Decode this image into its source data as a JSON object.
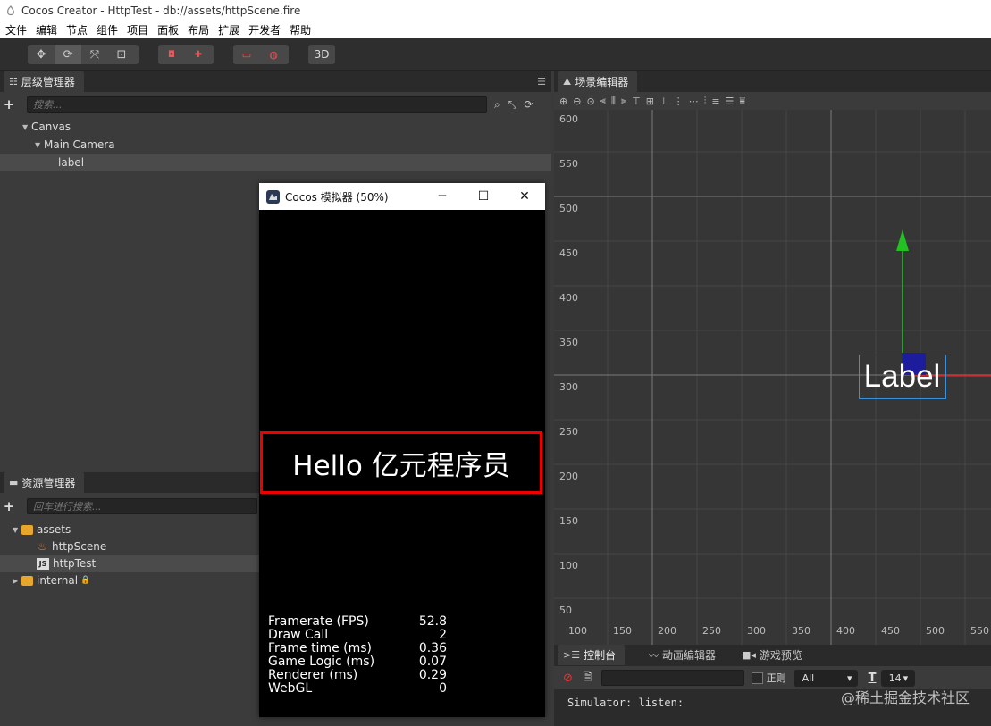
{
  "window": {
    "title": "Cocos Creator - HttpTest - db://assets/httpScene.fire"
  },
  "menu": [
    "文件",
    "编辑",
    "节点",
    "组件",
    "项目",
    "面板",
    "布局",
    "扩展",
    "开发者",
    "帮助"
  ],
  "toolbar": {
    "toggle_3d": "3D"
  },
  "hierarchy": {
    "tab": "层级管理器",
    "search_placeholder": "搜索...",
    "nodes": [
      {
        "label": "Canvas",
        "level": 0,
        "expanded": true
      },
      {
        "label": "Main Camera",
        "level": 1,
        "expanded": true
      },
      {
        "label": "label",
        "level": 2,
        "selected": true
      }
    ]
  },
  "assets": {
    "tab": "资源管理器",
    "search_placeholder": "回车进行搜索...",
    "items": [
      {
        "label": "assets",
        "type": "folder",
        "expanded": true
      },
      {
        "label": "httpScene",
        "type": "scene"
      },
      {
        "label": "httpTest",
        "type": "js",
        "selected": true
      },
      {
        "label": "internal",
        "type": "folder",
        "locked": true
      }
    ]
  },
  "scene": {
    "tab": "场景编辑器",
    "y_labels": [
      "600",
      "550",
      "500",
      "450",
      "400",
      "350",
      "300",
      "250",
      "200",
      "150",
      "100",
      "50"
    ],
    "x_labels": [
      "100",
      "150",
      "200",
      "250",
      "300",
      "350",
      "400",
      "450",
      "500",
      "550"
    ],
    "node_label": "Label"
  },
  "console": {
    "tabs": [
      "控制台",
      "动画编辑器",
      "游戏预览"
    ],
    "regex_label": "正则",
    "level_select": "All",
    "font_size": "14",
    "output": "Simulator: listen:"
  },
  "simulator": {
    "title": "Cocos 模拟器 (50%)",
    "hello_text": "Hello 亿元程序员",
    "stats": [
      {
        "name": "Framerate (FPS)",
        "value": "52.8"
      },
      {
        "name": "Draw Call",
        "value": "2"
      },
      {
        "name": "Frame time (ms)",
        "value": "0.36"
      },
      {
        "name": "Game Logic (ms)",
        "value": "0.07"
      },
      {
        "name": "Renderer (ms)",
        "value": "0.29"
      },
      {
        "name": "WebGL",
        "value": "0"
      }
    ]
  },
  "watermark": "@稀土掘金技术社区",
  "colors": {
    "highlight_border": "#ee0000",
    "x_axis": "#e01818",
    "y_axis": "#22c022",
    "anchor": "#1a1aa8"
  }
}
